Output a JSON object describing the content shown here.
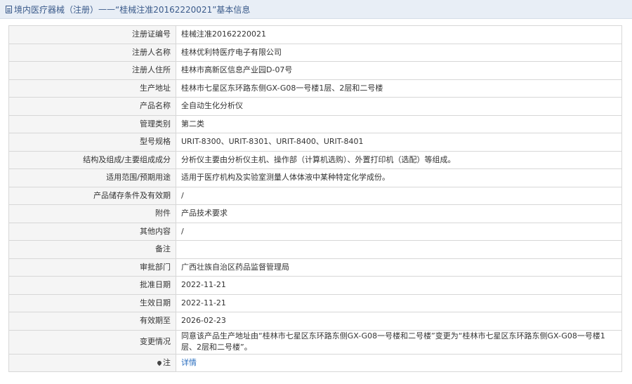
{
  "header": {
    "section": "境内医疗器械（注册）",
    "separator": " —— ",
    "title": "“桂械注准20162220021”基本信息"
  },
  "rows": [
    {
      "label": "注册证编号",
      "value": "桂械注准20162220021"
    },
    {
      "label": "注册人名称",
      "value": "桂林优利特医疗电子有限公司"
    },
    {
      "label": "注册人住所",
      "value": "桂林市高新区信息产业园D-07号"
    },
    {
      "label": "生产地址",
      "value": "桂林市七星区东环路东侧GX-G08一号楼1层、2层和二号楼"
    },
    {
      "label": "产品名称",
      "value": "全自动生化分析仪"
    },
    {
      "label": "管理类别",
      "value": "第二类"
    },
    {
      "label": "型号规格",
      "value": "URIT-8300、URIT-8301、URIT-8400、URIT-8401"
    },
    {
      "label": "结构及组成/主要组成成分",
      "value": "分析仪主要由分析仪主机、操作部（计算机选购）、外置打印机（选配）等组成。"
    },
    {
      "label": "适用范围/预期用途",
      "value": "适用于医疗机构及实验室测量人体体液中某种特定化学成份。"
    },
    {
      "label": "产品储存条件及有效期",
      "value": "/"
    },
    {
      "label": "附件",
      "value": "产品技术要求"
    },
    {
      "label": "其他内容",
      "value": "/"
    },
    {
      "label": "备注",
      "value": ""
    },
    {
      "label": "审批部门",
      "value": "广西壮族自治区药品监督管理局"
    },
    {
      "label": "批准日期",
      "value": "2022-11-21"
    },
    {
      "label": "生效日期",
      "value": "2022-11-21"
    },
    {
      "label": "有效期至",
      "value": "2026-02-23"
    },
    {
      "label": "变更情况",
      "value": "同意该产品生产地址由“桂林市七星区东环路东侧GX-G08一号楼和二号楼”变更为“桂林市七星区东环路东侧GX-G08一号楼1层、2层和二号楼”。"
    }
  ],
  "note": {
    "label": "注",
    "link": "详情",
    "icon": "map-pin-icon"
  }
}
